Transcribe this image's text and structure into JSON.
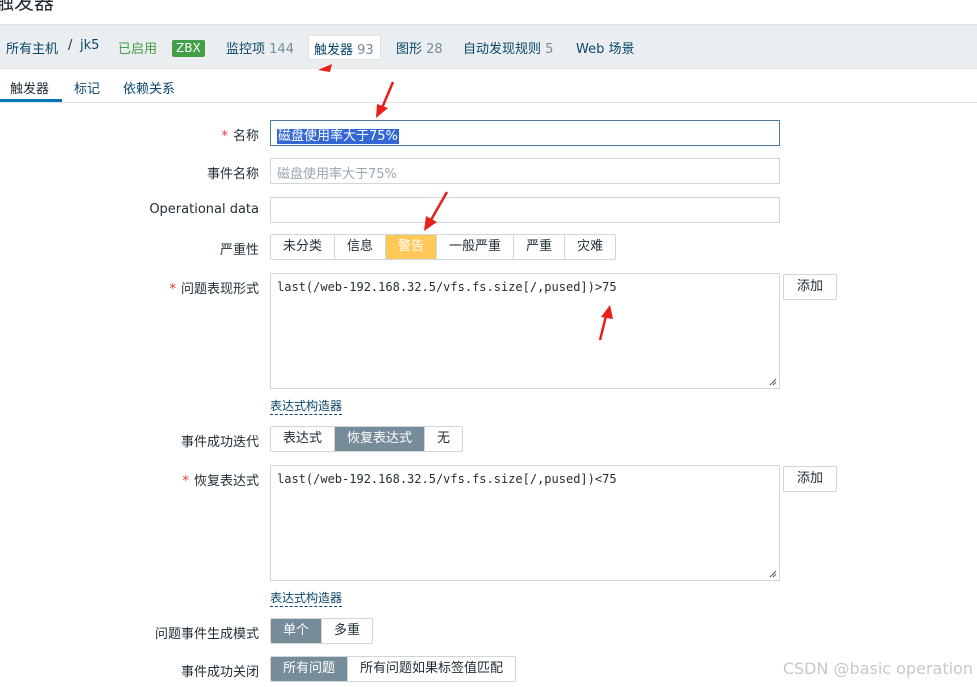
{
  "page": {
    "title": "触发器"
  },
  "breadcrumb": {
    "all_hosts": "所有主机",
    "separator": "/",
    "host": "jk5",
    "enabled": "已启用",
    "zbx": "ZBX",
    "items_label": "监控项",
    "items_count": "144",
    "triggers_label": "触发器",
    "triggers_count": "93",
    "graphs_label": "图形",
    "graphs_count": "28",
    "discovery_label": "自动发现规则",
    "discovery_count": "5",
    "web": "Web 场景"
  },
  "tabs": [
    "触发器",
    "标记",
    "依赖关系"
  ],
  "form": {
    "name_label": "名称",
    "name_value": "磁盘使用率大于75%",
    "event_name_label": "事件名称",
    "event_name_placeholder": "磁盘使用率大于75%",
    "opdata_label": "Operational data",
    "severity_label": "严重性",
    "severity_options": [
      "未分类",
      "信息",
      "警告",
      "一般严重",
      "严重",
      "灾难"
    ],
    "severity_selected": "警告",
    "problem_expr_label": "问题表现形式",
    "problem_expr_value": "last(/web-192.168.32.5/vfs.fs.size[/,pused])>75",
    "add_label": "添加",
    "expr_builder_label": "表达式构造器",
    "ok_event_label": "事件成功迭代",
    "ok_event_options": [
      "表达式",
      "恢复表达式",
      "无"
    ],
    "ok_event_selected": "恢复表达式",
    "recovery_expr_label": "恢复表达式",
    "recovery_expr_value": "last(/web-192.168.32.5/vfs.fs.size[/,pused])<75",
    "gen_mode_label": "问题事件生成模式",
    "gen_mode_options": [
      "单个",
      "多重"
    ],
    "gen_mode_selected": "单个",
    "ok_close_label": "事件成功关闭",
    "ok_close_options": [
      "所有问题",
      "所有问题如果标签值匹配"
    ],
    "ok_close_selected": "所有问题"
  },
  "watermark": "CSDN @basic operation",
  "colors": {
    "warning": "#ffc859",
    "active_segment": "#768d99",
    "required": "#e33734",
    "annotation_arrow": "#e8201a"
  }
}
